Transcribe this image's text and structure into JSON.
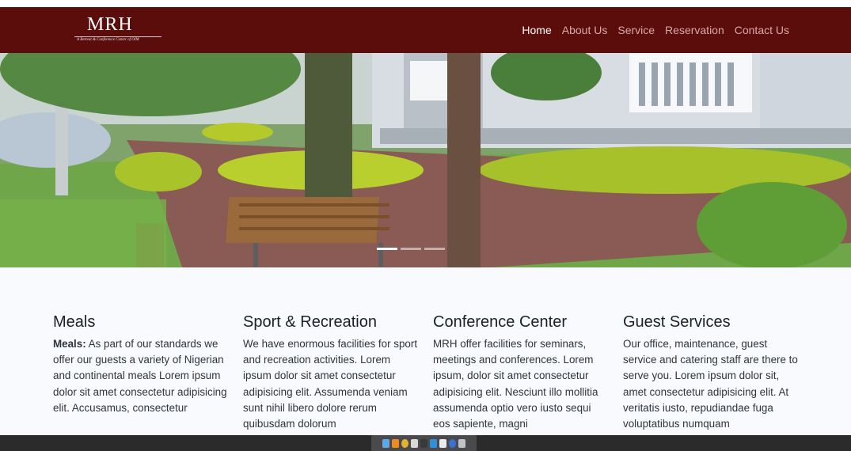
{
  "logo": {
    "title": "MRH",
    "subtitle": "A Retreat & Conference Center of OIM"
  },
  "nav": {
    "items": [
      {
        "label": "Home",
        "active": true
      },
      {
        "label": "About Us",
        "active": false
      },
      {
        "label": "Service",
        "active": false
      },
      {
        "label": "Reservation",
        "active": false
      },
      {
        "label": "Contact Us",
        "active": false
      }
    ]
  },
  "hero": {
    "slide_count": 3,
    "active_slide": 1
  },
  "features": [
    {
      "title": "Meals",
      "lead": "Meals:",
      "text": " As part of our standards we offer our guests a variety of Nigerian and continental meals Lorem ipsum dolor sit amet consectetur adipisicing elit. Accusamus, consectetur"
    },
    {
      "title": "Sport & Recreation",
      "lead": "",
      "text": "We have enormous facilities for sport and recreation activities. Lorem ipsum dolor sit amet consectetur adipisicing elit. Assumenda veniam sunt nihil libero dolore rerum quibusdam dolorum"
    },
    {
      "title": "Conference Center",
      "lead": "",
      "text": "MRH offer facilities for seminars, meetings and conferences. Lorem ipsum, dolor sit amet consectetur adipisicing elit. Nesciunt illo mollitia assumenda optio vero iusto sequi eos sapiente, magni"
    },
    {
      "title": "Guest Services",
      "lead": "",
      "text": "Our office, maintenance, guest service and catering staff are there to serve you. Lorem ipsum dolor sit, amet consectetur adipisicing elit. At veritatis iusto, repudiandae fuga voluptatibus numquam"
    }
  ],
  "dock": {
    "icons": [
      "finder-icon",
      "vlc-icon",
      "chrome-icon",
      "app-icon",
      "terminal-icon",
      "vscode-icon",
      "preview-icon",
      "browser-icon",
      "trash-icon"
    ]
  },
  "colors": {
    "navbar": "#5b0d0b",
    "nav_active": "#ffffff",
    "nav_inactive": "#d9a9a6",
    "page_bg": "#f8fafd"
  }
}
